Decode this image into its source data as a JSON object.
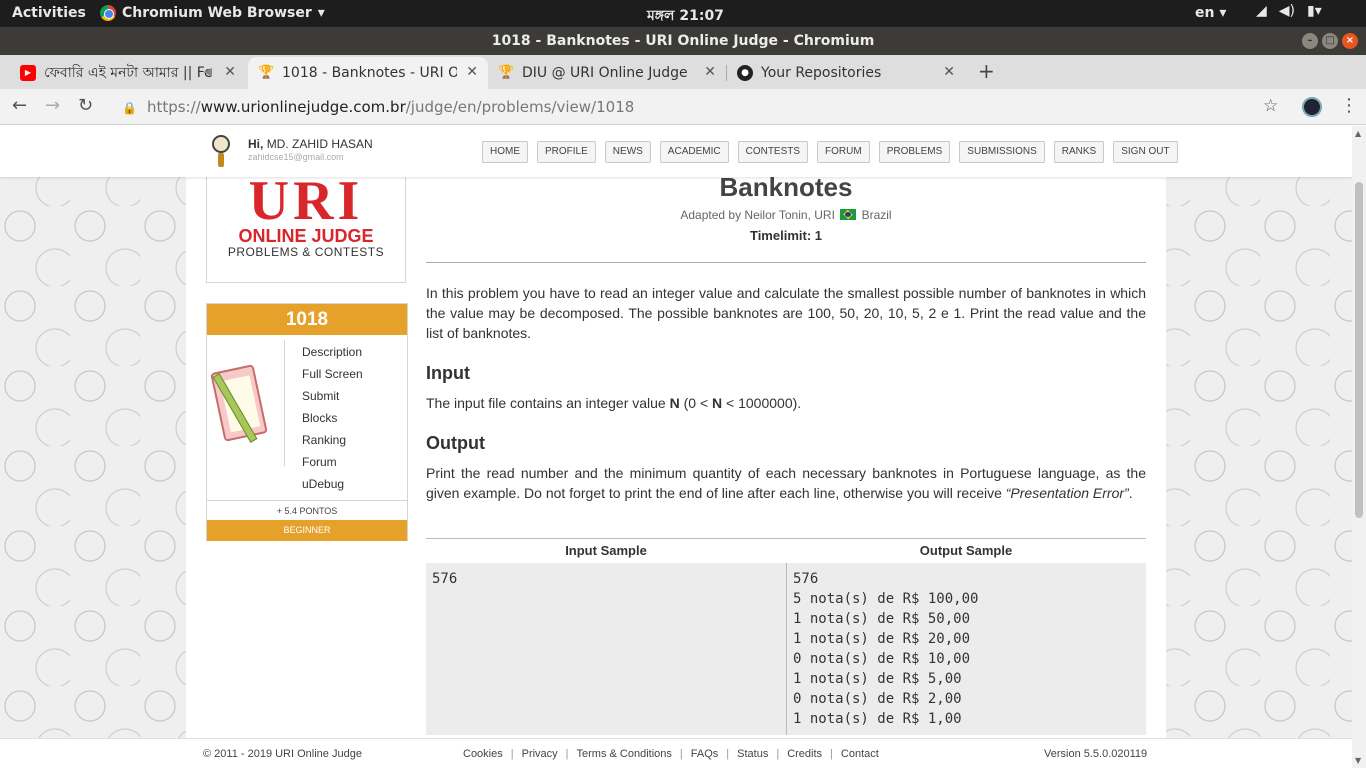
{
  "os": {
    "activities": "Activities",
    "app_name": "Chromium Web Browser",
    "clock": "মঙ্গল 21:07",
    "lang": "en"
  },
  "window": {
    "title": "1018 - Banknotes - URI Online Judge - Chromium"
  },
  "tabs": [
    {
      "label": "ফেবারি এই মনটা আমার || Fe",
      "icon": "youtube-icon",
      "active": false
    },
    {
      "label": "1018 - Banknotes - URI Onl",
      "icon": "trophy-icon",
      "active": true
    },
    {
      "label": "DIU @ URI Online Judge",
      "icon": "trophy-icon",
      "active": false
    },
    {
      "label": "Your Repositories",
      "icon": "github-icon",
      "active": false
    }
  ],
  "omnibox": {
    "scheme": "https://",
    "host": "www.urionlinejudge.com.br",
    "path": "/judge/en/problems/view/1018"
  },
  "site": {
    "user": {
      "greeting": "Hi,",
      "name": "MD. ZAHID HASAN",
      "email": "zahidcse15@gmail.com"
    },
    "nav": [
      "HOME",
      "PROFILE",
      "NEWS",
      "ACADEMIC",
      "CONTESTS",
      "FORUM",
      "PROBLEMS",
      "SUBMISSIONS",
      "RANKS",
      "SIGN OUT"
    ],
    "logo": {
      "main": "URI",
      "line1": "ONLINE JUDGE",
      "line2": "PROBLEMS & CONTESTS"
    }
  },
  "problem_box": {
    "number": "1018",
    "menu": [
      "Description",
      "Full Screen",
      "Submit",
      "Blocks",
      "Ranking",
      "Forum",
      "uDebug"
    ],
    "points": "+ 5.4 PONTOS",
    "level": "BEGINNER"
  },
  "problem": {
    "title": "Banknotes",
    "adapted_prefix": "Adapted by Neilor Tonin, URI",
    "adapted_country": "Brazil",
    "timelimit": "Timelimit: 1",
    "description": "In this problem you have to read an integer value and calculate the smallest possible number of banknotes in which the value may be decomposed. The possible banknotes are 100, 50, 20, 10, 5, 2 e 1. Print the read value and the list of banknotes.",
    "input_title": "Input",
    "input_pre": "The input file contains an integer value ",
    "input_n1": "N",
    "input_mid": " (0 < ",
    "input_n2": "N",
    "input_post": " < 1000000).",
    "output_title": "Output",
    "output_text": "Print the read number and the minimum quantity of each necessary banknotes in Portuguese language, as the given example. Do not forget to print the end of line after each line, otherwise you will receive ",
    "output_italic": "“Presentation Error”",
    "output_end": ".",
    "input_sample_header": "Input Sample",
    "output_sample_header": "Output Sample",
    "input_sample": "576",
    "output_sample": "576\n5 nota(s) de R$ 100,00\n1 nota(s) de R$ 50,00\n1 nota(s) de R$ 20,00\n0 nota(s) de R$ 10,00\n1 nota(s) de R$ 5,00\n0 nota(s) de R$ 2,00\n1 nota(s) de R$ 1,00"
  },
  "footer": {
    "copyright": "© 2011 - 2019 URI Online Judge",
    "links": [
      "Cookies",
      "Privacy",
      "Terms & Conditions",
      "FAQs",
      "Status",
      "Credits",
      "Contact"
    ],
    "version": "Version 5.5.0.020119"
  },
  "colors": {
    "accent": "#e6a12b",
    "logo_red": "#d9262a",
    "ubuntu_orange": "#e95420"
  }
}
